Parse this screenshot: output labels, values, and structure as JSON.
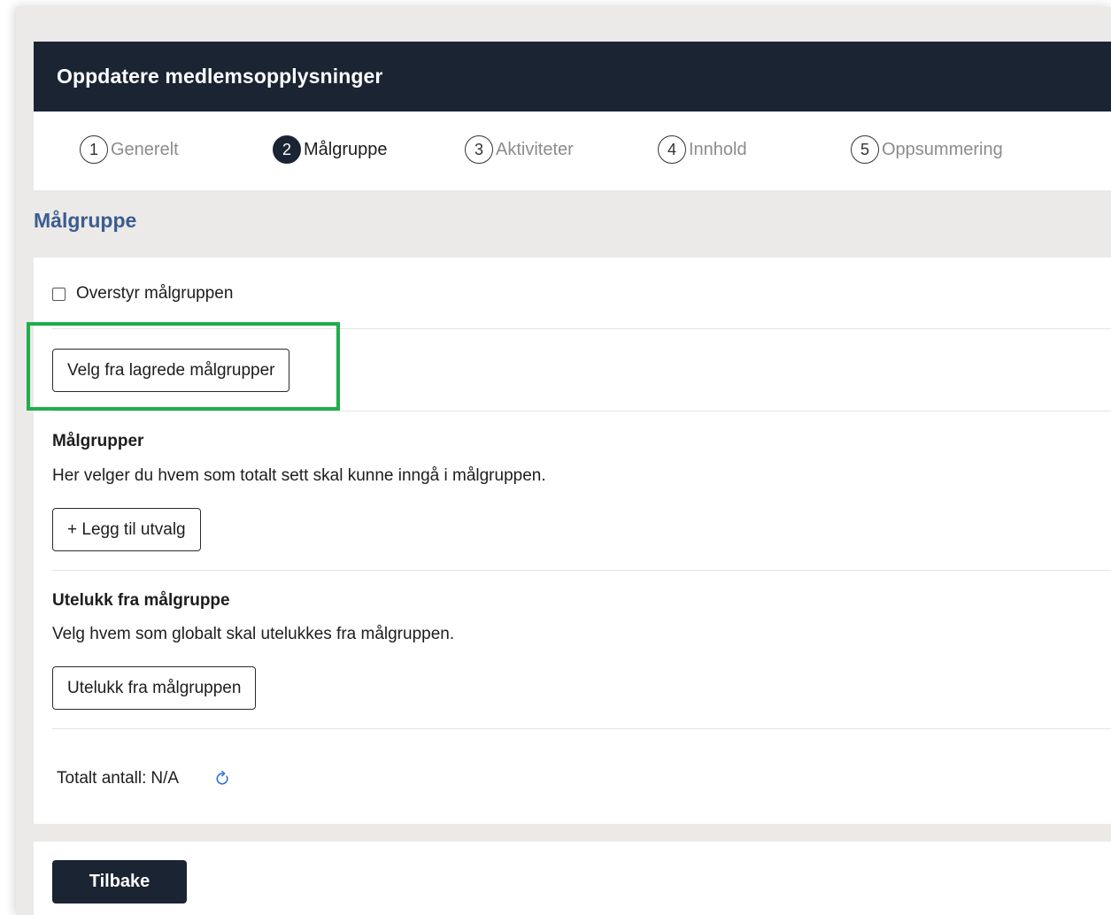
{
  "header": {
    "title": "Oppdatere medlemsopplysninger"
  },
  "stepper": {
    "steps": [
      {
        "number": "1",
        "label": "Generelt",
        "active": false
      },
      {
        "number": "2",
        "label": "Målgruppe",
        "active": true
      },
      {
        "number": "3",
        "label": "Aktiviteter",
        "active": false
      },
      {
        "number": "4",
        "label": "Innhold",
        "active": false
      },
      {
        "number": "5",
        "label": "Oppsummering",
        "active": false
      }
    ]
  },
  "section": {
    "title": "Målgruppe"
  },
  "override": {
    "label": "Overstyr målgruppen",
    "checked": false
  },
  "saved_groups": {
    "button_label": "Velg fra lagrede målgrupper"
  },
  "target_groups": {
    "title": "Målgrupper",
    "description": "Her velger du hvem som totalt sett skal kunne inngå i målgruppen.",
    "add_button_label": "+ Legg til utvalg"
  },
  "exclude": {
    "title": "Utelukk fra målgruppe",
    "description": "Velg hvem som globalt skal utelukkes fra målgruppen.",
    "button_label": "Utelukk fra målgruppen"
  },
  "total": {
    "label": "Totalt antall:",
    "value": "N/A"
  },
  "footer": {
    "back_label": "Tilbake"
  },
  "colors": {
    "header_bg": "#1a2433",
    "accent_title": "#3a5d8f",
    "highlight": "#22ac4c",
    "refresh_icon": "#2f6fd6"
  },
  "icons": {
    "refresh": "refresh-icon"
  }
}
